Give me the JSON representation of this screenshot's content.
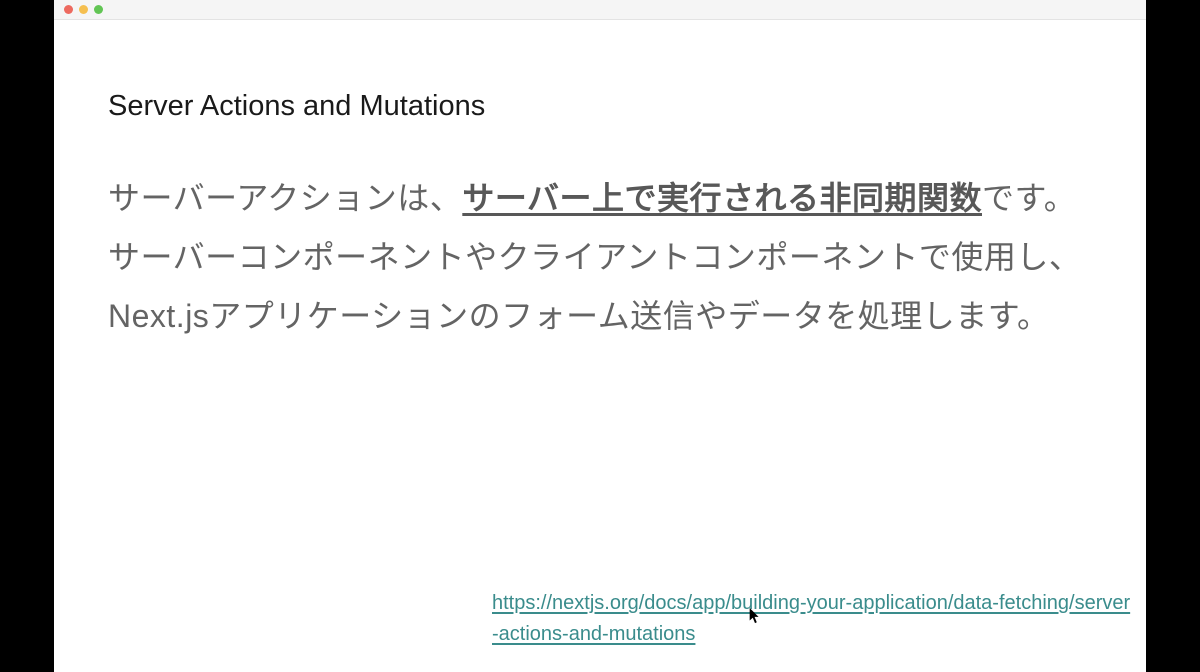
{
  "slide": {
    "title": "Server Actions and Mutations",
    "body_pre": "サーバーアクションは、",
    "body_emph": "サーバー上で実行される非同期関数",
    "body_post": "です。サーバーコンポーネントやクライアントコンポーネントで使用し、Next.jsアプリケーションのフォーム送信やデータを処理します。",
    "link_text": "https://nextjs.org/docs/app/building-your-application/data-fetching/server-actions-and-mutations",
    "link_href": "https://nextjs.org/docs/app/building-your-application/data-fetching/server-actions-and-mutations"
  }
}
